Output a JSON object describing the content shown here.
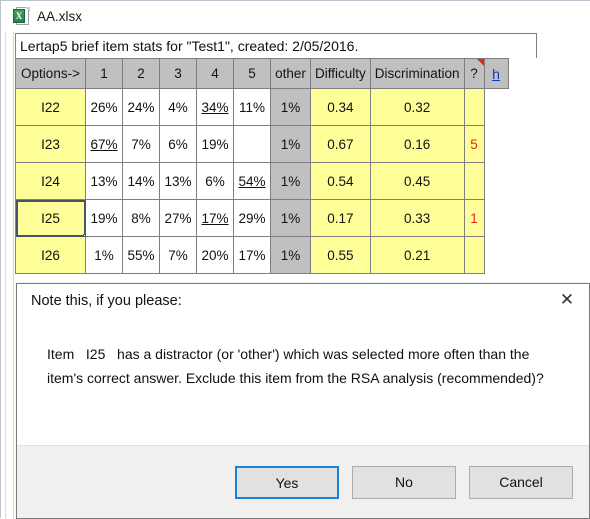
{
  "window": {
    "title": "AA.xlsx",
    "icon": "excel-file-icon",
    "icon_letter": "X"
  },
  "sheet": {
    "caption": "Lertap5 brief item stats for \"Test1\", created: 2/05/2016.",
    "help_link": "h",
    "headers": {
      "options": "Options->",
      "opt1": "1",
      "opt2": "2",
      "opt3": "3",
      "opt4": "4",
      "opt5": "5",
      "other": "other",
      "difficulty": "Difficulty",
      "discrimination": "Discrimination",
      "flag": "?"
    },
    "rows": [
      {
        "item": "I22",
        "o1": "26%",
        "o2": "24%",
        "o3": "4%",
        "o4": "34%",
        "o5": "11%",
        "correct": "o4",
        "other": "1%",
        "difficulty": "0.34",
        "discrimination": "0.32",
        "flag": "",
        "selected": false
      },
      {
        "item": "I23",
        "o1": "67%",
        "o2": "7%",
        "o3": "6%",
        "o4": "19%",
        "o5": "",
        "correct": "o1",
        "other": "1%",
        "difficulty": "0.67",
        "discrimination": "0.16",
        "flag": "5",
        "selected": false
      },
      {
        "item": "I24",
        "o1": "13%",
        "o2": "14%",
        "o3": "13%",
        "o4": "6%",
        "o5": "54%",
        "correct": "o5",
        "other": "1%",
        "difficulty": "0.54",
        "discrimination": "0.45",
        "flag": "",
        "selected": false
      },
      {
        "item": "I25",
        "o1": "19%",
        "o2": "8%",
        "o3": "27%",
        "o4": "17%",
        "o5": "29%",
        "correct": "o4",
        "other": "1%",
        "difficulty": "0.17",
        "discrimination": "0.33",
        "flag": "1",
        "selected": true
      },
      {
        "item": "I26",
        "o1": "1%",
        "o2": "55%",
        "o3": "7%",
        "o4": "20%",
        "o5": "17%",
        "correct": "",
        "other": "1%",
        "difficulty": "0.55",
        "discrimination": "0.21",
        "flag": "",
        "selected": false
      }
    ]
  },
  "dialog": {
    "title": "Note this, if you please:",
    "close_icon": "close-icon",
    "message": "Item   I25   has a distractor (or 'other') which was selected more often than the item's correct answer. Exclude this item from the RSA analysis (recommended)?",
    "buttons": {
      "yes": "Yes",
      "no": "No",
      "cancel": "Cancel"
    }
  },
  "colors": {
    "row_yellow": "#ffff99",
    "header_gray": "#c0c0c0",
    "other_gray": "#c0c0c0",
    "flag_red": "#e8261c",
    "link_blue": "#0a39c9",
    "focus_blue": "#1782d8",
    "selection_border": "#44546a"
  }
}
